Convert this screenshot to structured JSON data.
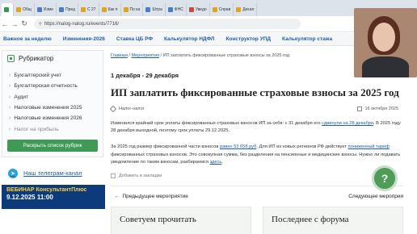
{
  "browser": {
    "tabs": [
      {
        "label": "",
        "active": true
      },
      {
        "label": "Общ",
        "active": false
      },
      {
        "label": "Изме",
        "active": false
      },
      {
        "label": "Пред",
        "active": false
      },
      {
        "label": "С 27",
        "active": false
      },
      {
        "label": "Как п",
        "active": false
      },
      {
        "label": "По ка",
        "active": false
      },
      {
        "label": "Штра",
        "active": false
      },
      {
        "label": "ФНС",
        "active": false
      },
      {
        "label": "Уведо",
        "active": false
      },
      {
        "label": "Справ",
        "active": false
      },
      {
        "label": "Декал",
        "active": false
      }
    ],
    "url": "https://nalog-nalog.ru/events/7716/"
  },
  "topnav": [
    "Важное за неделю",
    "Изменения-2026",
    "Ставка ЦБ РФ",
    "Калькулятор НДФЛ",
    "Конструктор УПД",
    "Калькулятор стажа"
  ],
  "sidebar": {
    "title": "Рубрикатор",
    "items": [
      "Бухгалтерский учет",
      "Бухгалтерская отчетность",
      "Аудит",
      "Налоговые изменения 2025",
      "Налоговые изменения 2026",
      "Налог на прибыль"
    ],
    "expand_label": "Раскрыть список рубрик",
    "telegram_label": "Наш телеграм-канал",
    "webinar_title": "ВЕБИНАР КонсультантПлюс",
    "webinar_date": "9.12.2025 11:00"
  },
  "main": {
    "breadcrumb": {
      "home": "Главная",
      "sep": "/",
      "section": "Мероприятия",
      "current": "ИП заплатить фиксированные страховые взносы за 2025 год"
    },
    "date_range": "1 декабря - 29 декабря",
    "title": "ИП заплатить фиксированные страховые взносы за 2025 год",
    "tag": "Налог-налог",
    "pub_date": "16 октября 2025",
    "para1": {
      "t1": "Изменился крайний срок уплаты фиксированных страховых взносов ИП за себя: с 31 декабря его ",
      "link": "сдвинули на 28 декабря",
      "t2": ". В 2025 году 28 декабря выходной, поэтому срок уплаты 29.12.2025."
    },
    "para2": {
      "t1": "За 2025 год размер фиксированной части взносов ",
      "amount": "равен 53 658 руб",
      "t2": ". Для ИП из новых регионов РФ действует ",
      "link": "пониженный тариф",
      "t3": " фиксированных страховых взносов. Это совокупная сумма, без разделения на пенсионные и медицинские взносы. Нужно ли подавать уведомление по таким взносам, разбираемся ",
      "here": "здесь",
      "t4": "."
    },
    "favorite_label": "Добавить в закладки",
    "prev_label": "Предыдущее мероприятие",
    "next_label": "Следующее мероприя",
    "card_left": "Советуем прочитать",
    "card_right": "Последнее с форума"
  },
  "help_symbol": "?"
}
